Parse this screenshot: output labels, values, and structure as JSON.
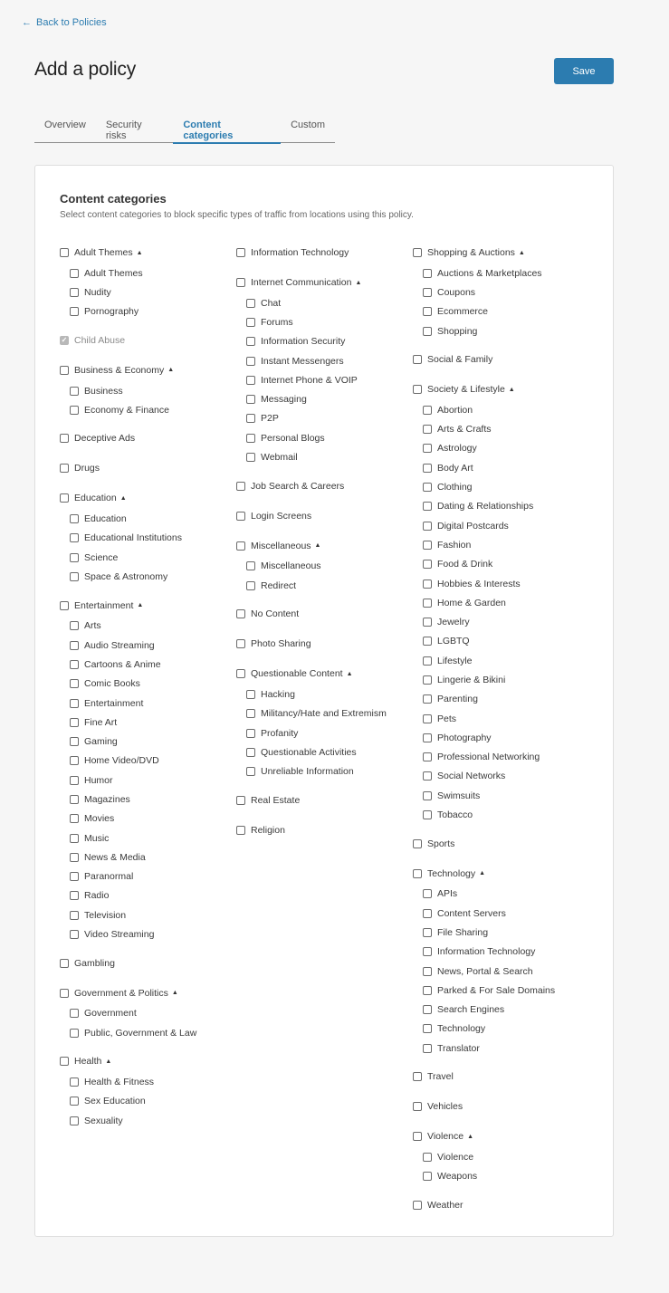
{
  "back_link": {
    "icon": "arrow-left-icon",
    "label": "Back to Policies"
  },
  "page_title": "Add a policy",
  "save_label": "Save",
  "tabs": [
    {
      "label": "Overview",
      "active": false
    },
    {
      "label": "Security risks",
      "active": false
    },
    {
      "label": "Content categories",
      "active": true
    },
    {
      "label": "Custom",
      "active": false
    }
  ],
  "card": {
    "title": "Content categories",
    "description": "Select content categories to block specific types of traffic from locations using this policy."
  },
  "colors": {
    "accent": "#2c7cb0",
    "background": "#f6f6f6"
  },
  "columns": [
    [
      {
        "label": "Adult Themes",
        "expanded": true,
        "children": [
          "Adult Themes",
          "Nudity",
          "Pornography"
        ]
      },
      {
        "label": "Child Abuse",
        "checked": true,
        "disabled": true,
        "children": []
      },
      {
        "label": "Business & Economy",
        "expanded": true,
        "children": [
          "Business",
          "Economy & Finance"
        ]
      },
      {
        "label": "Deceptive Ads",
        "children": []
      },
      {
        "label": "Drugs",
        "children": []
      },
      {
        "label": "Education",
        "expanded": true,
        "children": [
          "Education",
          "Educational Institutions",
          "Science",
          "Space & Astronomy"
        ]
      },
      {
        "label": "Entertainment",
        "expanded": true,
        "children": [
          "Arts",
          "Audio Streaming",
          "Cartoons & Anime",
          "Comic Books",
          "Entertainment",
          "Fine Art",
          "Gaming",
          "Home Video/DVD",
          "Humor",
          "Magazines",
          "Movies",
          "Music",
          "News & Media",
          "Paranormal",
          "Radio",
          "Television",
          "Video Streaming"
        ]
      },
      {
        "label": "Gambling",
        "children": []
      },
      {
        "label": "Government & Politics",
        "expanded": true,
        "children": [
          "Government",
          "Public, Government & Law"
        ]
      },
      {
        "label": "Health",
        "expanded": true,
        "children": [
          "Health & Fitness",
          "Sex Education",
          "Sexuality"
        ]
      }
    ],
    [
      {
        "label": "Information Technology",
        "children": []
      },
      {
        "label": "Internet Communication",
        "expanded": true,
        "children": [
          "Chat",
          "Forums",
          "Information Security",
          "Instant Messengers",
          "Internet Phone & VOIP",
          "Messaging",
          "P2P",
          "Personal Blogs",
          "Webmail"
        ]
      },
      {
        "label": "Job Search & Careers",
        "children": []
      },
      {
        "label": "Login Screens",
        "children": []
      },
      {
        "label": "Miscellaneous",
        "expanded": true,
        "children": [
          "Miscellaneous",
          "Redirect"
        ]
      },
      {
        "label": "No Content",
        "children": []
      },
      {
        "label": "Photo Sharing",
        "children": []
      },
      {
        "label": "Questionable Content",
        "expanded": true,
        "children": [
          "Hacking",
          "Militancy/Hate and Extremism",
          "Profanity",
          "Questionable Activities",
          "Unreliable Information"
        ]
      },
      {
        "label": "Real Estate",
        "children": []
      },
      {
        "label": "Religion",
        "children": []
      }
    ],
    [
      {
        "label": "Shopping & Auctions",
        "expanded": true,
        "children": [
          "Auctions & Marketplaces",
          "Coupons",
          "Ecommerce",
          "Shopping"
        ]
      },
      {
        "label": "Social & Family",
        "children": []
      },
      {
        "label": "Society & Lifestyle",
        "expanded": true,
        "children": [
          "Abortion",
          "Arts & Crafts",
          "Astrology",
          "Body Art",
          "Clothing",
          "Dating & Relationships",
          "Digital Postcards",
          "Fashion",
          "Food & Drink",
          "Hobbies & Interests",
          "Home & Garden",
          "Jewelry",
          "LGBTQ",
          "Lifestyle",
          "Lingerie & Bikini",
          "Parenting",
          "Pets",
          "Photography",
          "Professional Networking",
          "Social Networks",
          "Swimsuits",
          "Tobacco"
        ]
      },
      {
        "label": "Sports",
        "children": []
      },
      {
        "label": "Technology",
        "expanded": true,
        "children": [
          "APIs",
          "Content Servers",
          "File Sharing",
          "Information Technology",
          "News, Portal & Search",
          "Parked & For Sale Domains",
          "Search Engines",
          "Technology",
          "Translator"
        ]
      },
      {
        "label": "Travel",
        "children": []
      },
      {
        "label": "Vehicles",
        "children": []
      },
      {
        "label": "Violence",
        "expanded": true,
        "children": [
          "Violence",
          "Weapons"
        ]
      },
      {
        "label": "Weather",
        "children": []
      }
    ]
  ]
}
